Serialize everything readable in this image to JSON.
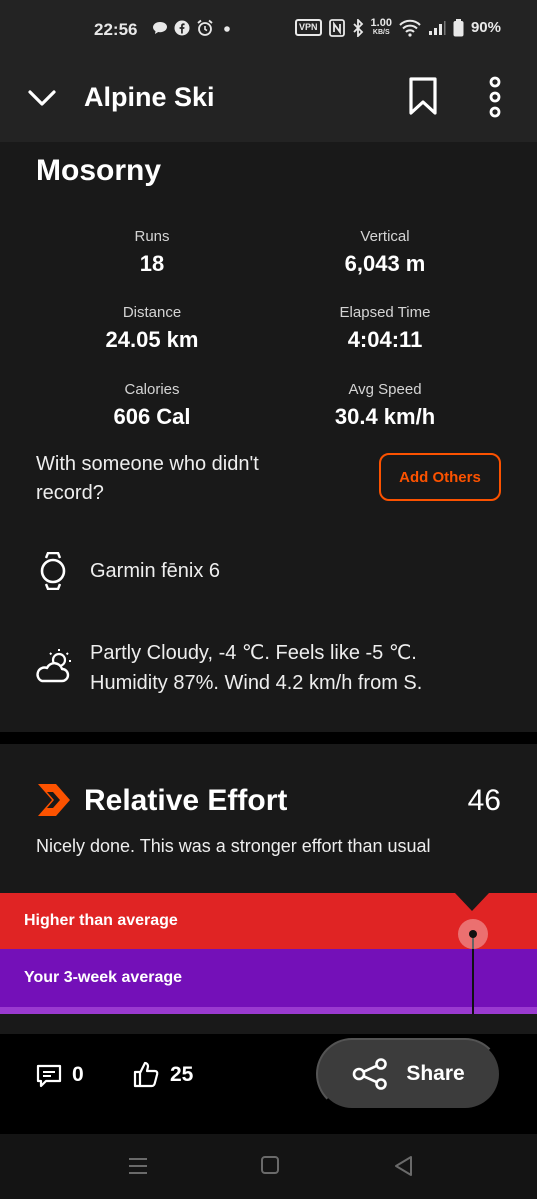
{
  "status_bar": {
    "time": "22:56",
    "vpn": "VPN",
    "net_speed_value": "1.00",
    "net_speed_unit": "KB/S",
    "battery": "90%",
    "icons": [
      "chat-bubble-icon",
      "facebook-icon",
      "alarm-icon",
      "dot-icon",
      "vpn-icon",
      "nfc-icon",
      "bluetooth-icon",
      "wifi-icon",
      "signal-icon",
      "battery-icon"
    ]
  },
  "app_bar": {
    "title": "Alpine Ski",
    "icons": [
      "chevron-down-icon",
      "bookmark-icon",
      "more-vertical-icon"
    ]
  },
  "activity": {
    "name": "Mosorny",
    "stats": [
      {
        "label": "Runs",
        "value": "18"
      },
      {
        "label": "Vertical",
        "value": "6,043 m"
      },
      {
        "label": "Distance",
        "value": "24.05 km"
      },
      {
        "label": "Elapsed Time",
        "value": "4:04:11"
      },
      {
        "label": "Calories",
        "value": "606 Cal"
      },
      {
        "label": "Avg Speed",
        "value": "30.4 km/h"
      }
    ],
    "with_others_text": "With someone who didn't record?",
    "add_others_label": "Add Others",
    "device": "Garmin fēnix 6",
    "weather_line1": "Partly Cloudy, -4 ℃. Feels like -5 ℃.",
    "weather_line2": "Humidity 87%. Wind 4.2 km/h from S."
  },
  "relative_effort": {
    "title": "Relative Effort",
    "score": "46",
    "description": "Nicely done. This was a stronger effort than usual",
    "bands": [
      {
        "label": "Higher than average",
        "color": "#e02424"
      },
      {
        "label": "Your 3-week average",
        "color": "#7410b8"
      }
    ],
    "accent_color": "#fc5200"
  },
  "footer": {
    "comments": "0",
    "kudos": "25",
    "share_label": "Share"
  },
  "system_nav": {
    "icons": [
      "recent-apps-icon",
      "home-icon",
      "back-icon"
    ]
  }
}
